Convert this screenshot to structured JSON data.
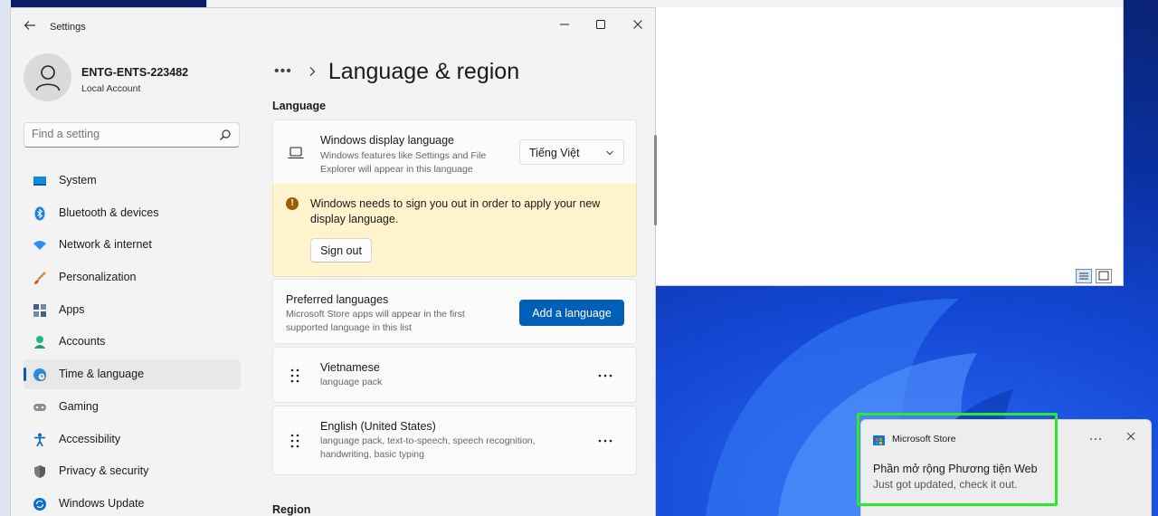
{
  "window": {
    "title": "Settings"
  },
  "account": {
    "name": "ENTG-ENTS-223482",
    "type": "Local Account"
  },
  "search": {
    "placeholder": "Find a setting"
  },
  "sidebar": {
    "items": [
      {
        "label": "System",
        "icon": "system-icon",
        "color": "#0078d4"
      },
      {
        "label": "Bluetooth & devices",
        "icon": "bluetooth-icon",
        "color": "#0078d4"
      },
      {
        "label": "Network & internet",
        "icon": "wifi-icon",
        "color": "#1e88e5"
      },
      {
        "label": "Personalization",
        "icon": "brush-icon",
        "color": "#e06c3a"
      },
      {
        "label": "Apps",
        "icon": "apps-icon",
        "color": "#3b5a80"
      },
      {
        "label": "Accounts",
        "icon": "accounts-icon",
        "color": "#1fae84"
      },
      {
        "label": "Time & language",
        "icon": "globe-clock-icon",
        "color": "#1f7fd1",
        "active": true
      },
      {
        "label": "Gaming",
        "icon": "gamepad-icon",
        "color": "#8a8a8a"
      },
      {
        "label": "Accessibility",
        "icon": "accessibility-icon",
        "color": "#0a6ed1"
      },
      {
        "label": "Privacy & security",
        "icon": "shield-icon",
        "color": "#6b6b6b"
      },
      {
        "label": "Windows Update",
        "icon": "update-icon",
        "color": "#0a6ed1"
      }
    ]
  },
  "page": {
    "breadcrumb_more": "•••",
    "title": "Language & region",
    "section_language": "Language",
    "section_region": "Region"
  },
  "display_language": {
    "title": "Windows display language",
    "description": "Windows features like Settings and File Explorer will appear in this language",
    "selected": "Tiếng Việt"
  },
  "warning": {
    "text": "Windows needs to sign you out in order to apply your new display language.",
    "button": "Sign out",
    "color": "#fff4ce"
  },
  "preferred": {
    "title": "Preferred languages",
    "description": "Microsoft Store apps will appear in the first supported language in this list",
    "button": "Add a language",
    "accent": "#005fb8"
  },
  "languages": [
    {
      "name": "Vietnamese",
      "details": "language pack"
    },
    {
      "name": "English (United States)",
      "details": "language pack, text-to-speech, speech recognition, handwriting, basic typing"
    }
  ],
  "toast": {
    "app": "Microsoft Store",
    "title": "Phần mở rộng Phương tiện Web",
    "body": "Just got updated, check it out.",
    "highlight_color": "#2bea2b"
  }
}
